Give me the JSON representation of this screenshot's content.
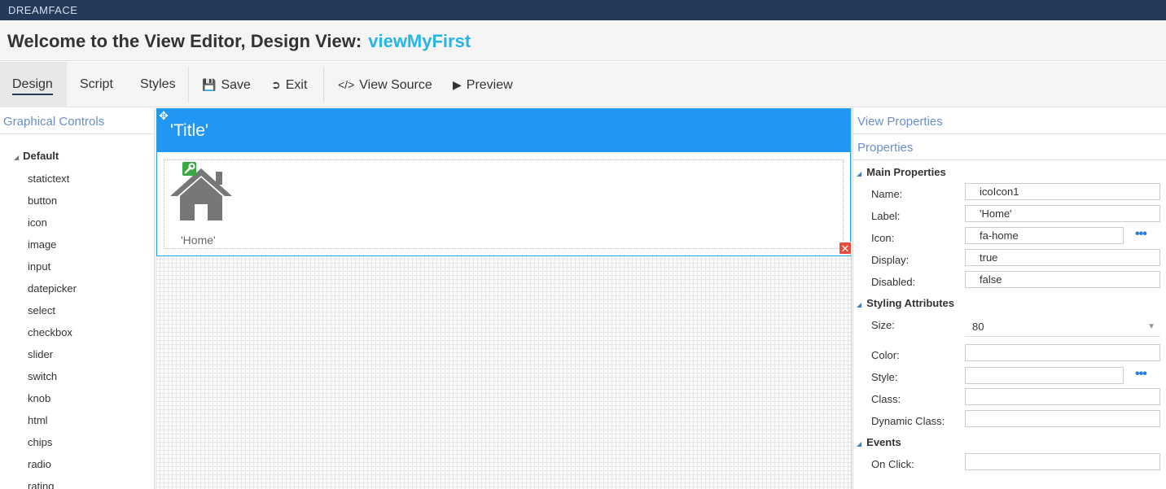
{
  "app": {
    "brand": "DREAMFACE"
  },
  "title": {
    "prefix": "Welcome to the View Editor, Design View:",
    "view_name": "viewMyFirst"
  },
  "toolbar": {
    "design": "Design",
    "script": "Script",
    "styles": "Styles",
    "save": "Save",
    "exit": "Exit",
    "view_source": "View Source",
    "preview": "Preview"
  },
  "left_panel": {
    "title": "Graphical Controls",
    "root": "Default",
    "items": [
      "statictext",
      "button",
      "icon",
      "image",
      "input",
      "datepicker",
      "select",
      "checkbox",
      "slider",
      "switch",
      "knob",
      "html",
      "chips",
      "radio",
      "rating"
    ]
  },
  "canvas": {
    "header_title": "'Title'",
    "icon_label": "'Home'",
    "icon_name": "home-icon"
  },
  "right_panel": {
    "view_properties": "View Properties",
    "properties": "Properties",
    "main_section": "Main Properties",
    "name_label": "Name:",
    "name_value": "icoIcon1",
    "label_label": "Label:",
    "label_value": "'Home'",
    "icon_label": "Icon:",
    "icon_value": "fa-home",
    "display_label": "Display:",
    "display_value": "true",
    "disabled_label": "Disabled:",
    "disabled_value": "false",
    "styling_section": "Styling Attributes",
    "size_label": "Size:",
    "size_value": "80",
    "color_label": "Color:",
    "color_value": "",
    "style_label": "Style:",
    "style_value": "",
    "class_label": "Class:",
    "class_value": "",
    "dynclass_label": "Dynamic Class:",
    "dynclass_value": "",
    "events_section": "Events",
    "onclick_label": "On Click:",
    "onclick_value": "",
    "more": "•••"
  },
  "colors": {
    "brand_bar": "#253a5b",
    "accent": "#27b5e4",
    "header_blue": "#2196f3",
    "link_blue": "#6b8fc7"
  }
}
